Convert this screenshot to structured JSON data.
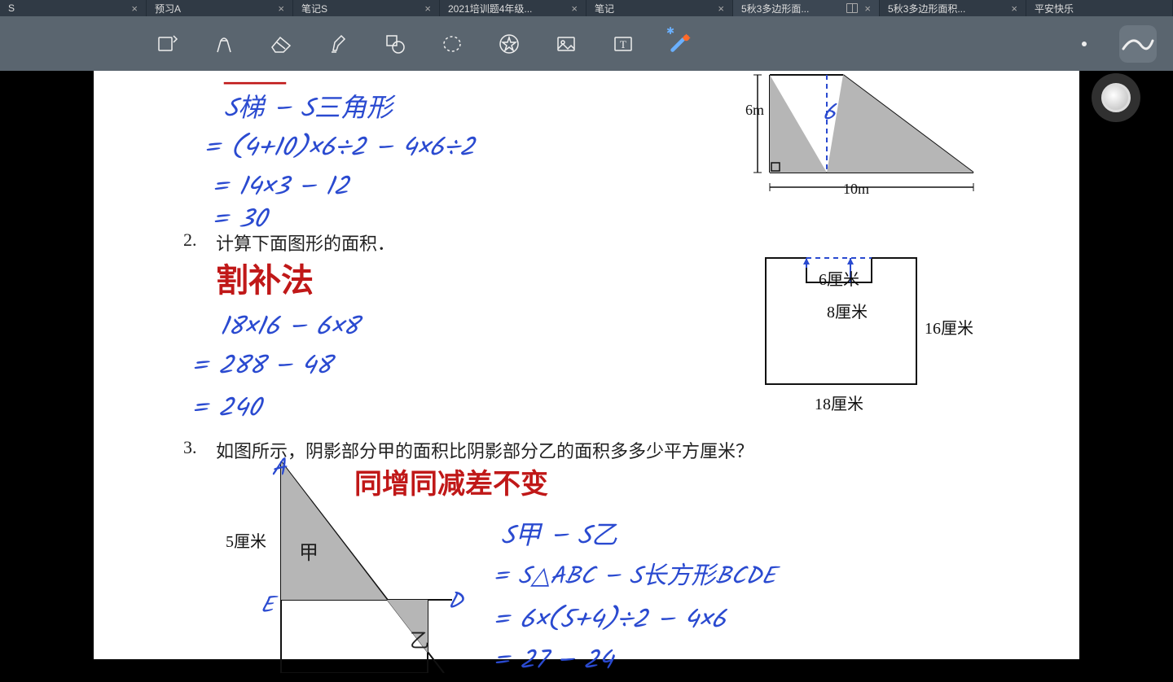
{
  "tabs": [
    {
      "label": "S",
      "close": "×"
    },
    {
      "label": "预习A",
      "close": "×"
    },
    {
      "label": "笔记S",
      "close": "×"
    },
    {
      "label": "2021培训题4年级...",
      "close": "×"
    },
    {
      "label": "笔记",
      "close": "×"
    },
    {
      "label": "5秋3多边形面...",
      "close": "×",
      "active": true,
      "split": true
    },
    {
      "label": "5秋3多边形面积...",
      "close": "×"
    },
    {
      "label": "平安快乐",
      "close": ""
    }
  ],
  "toolbar": {
    "icons": [
      "rotate-icon",
      "pen-icon",
      "eraser-icon",
      "highlighter-icon",
      "shapes-icon",
      "lasso-icon",
      "stamp-icon",
      "image-icon",
      "text-icon",
      "laser-icon"
    ]
  },
  "diagram1": {
    "h": "6m",
    "w": "10m",
    "inner": "6"
  },
  "problem1": {
    "hand1": "S梯 − S三角形",
    "hand2": "= (4+10)×6÷2 − 4×6÷2",
    "hand3": "= 14×3 − 12",
    "hand4": "= 30"
  },
  "problem2": {
    "number": "2.",
    "text": "计算下面图形的面积．",
    "method": "割补法",
    "c1": "18×16 − 6×8",
    "c2": "= 288 − 48",
    "c3": "= 240",
    "dim_top": "6厘米",
    "dim_inner": "8厘米",
    "dim_right": "16厘米",
    "dim_bottom": "18厘米"
  },
  "problem3": {
    "number": "3.",
    "text": "如图所示，阴影部分甲的面积比阴影部分乙的面积多多少平方厘米？",
    "principle": "同增同减差不变",
    "lab_A": "A",
    "lab_E": "E",
    "lab_D": "D",
    "lab_jia": "甲",
    "lab_yi": "乙",
    "side": "5厘米",
    "s1": "S甲 − S乙",
    "s2": "= S△ABC − S长方形BCDE",
    "s3": "= 6×(5+4)÷2 − 4×6",
    "s4": "= 27 − 24"
  }
}
